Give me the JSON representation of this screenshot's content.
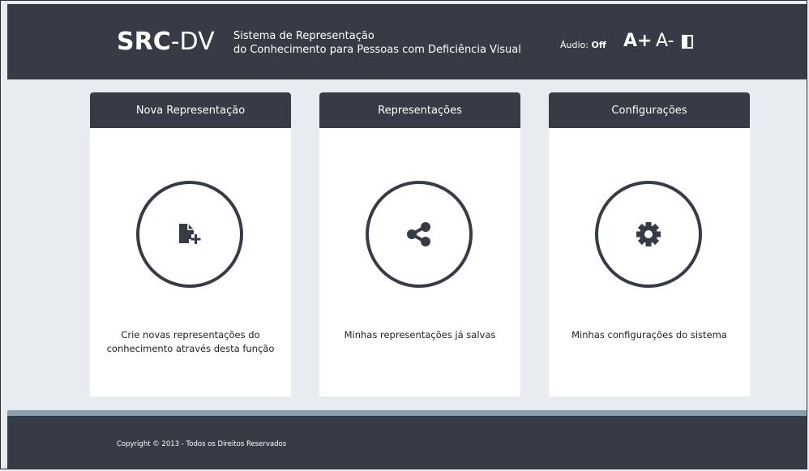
{
  "header": {
    "logo_bold": "SRC",
    "logo_thin": "-DV",
    "tagline_line1": "Sistema de Representação",
    "tagline_line2": "do Conhecimento para Pessoas com Deficiência Visual",
    "audio_label": "Áudio:",
    "audio_state": "Off",
    "font_increase": "A+",
    "font_decrease": "A-"
  },
  "cards": [
    {
      "title": "Nova Representação",
      "icon": "new-file-icon",
      "description": "Crie novas representações do conhecimento através desta função"
    },
    {
      "title": "Representações",
      "icon": "share-icon",
      "description": "Minhas representações já salvas"
    },
    {
      "title": "Configurações",
      "icon": "gear-icon",
      "description": "Minhas configurações do sistema"
    }
  ],
  "footer": {
    "copyright": "Copyright © 2013 - Todos os Direitos Reservados"
  },
  "colors": {
    "dark": "#363b45",
    "background": "#e8ecf0",
    "strip": "#8aa0ae"
  }
}
